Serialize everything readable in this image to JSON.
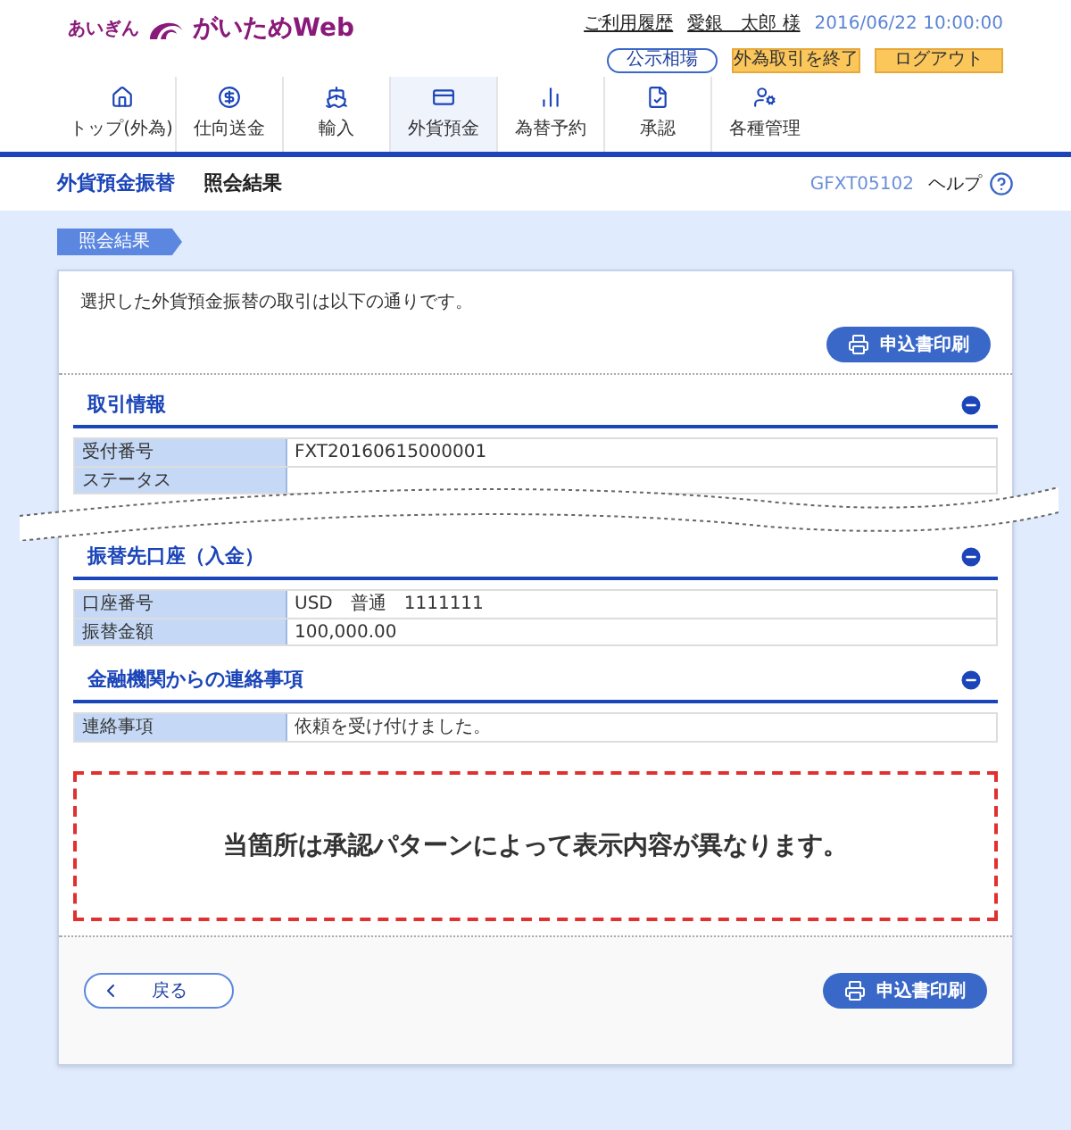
{
  "header": {
    "logo_small": "あいぎん",
    "logo": "がいためWeb",
    "history_link": "ご利用履歴",
    "user_name": "愛銀　太郎 様",
    "datetime": "2016/06/22 10:00:00"
  },
  "header_buttons": [
    {
      "label": "公示相場",
      "kind": "outline"
    },
    {
      "label": "外為取引を終了",
      "kind": "warning"
    },
    {
      "label": "ログアウト",
      "kind": "warning"
    }
  ],
  "nav": [
    {
      "label": "トップ(外為)",
      "selected": false
    },
    {
      "label": "仕向送金",
      "selected": false
    },
    {
      "label": "輸入",
      "selected": false
    },
    {
      "label": "外貨預金",
      "selected": true
    },
    {
      "label": "為替予約",
      "selected": false
    },
    {
      "label": "承認",
      "selected": false
    },
    {
      "label": "各種管理",
      "selected": false
    }
  ],
  "page": {
    "title": "外貨預金振替",
    "subtitle": "照会結果",
    "screen_id": "GFXT05102",
    "help": "ヘルプ"
  },
  "breadcrumb": "照会結果",
  "intro": "選択した外貨預金振替の取引は以下の通りです。",
  "print_button": "申込書印刷",
  "sections": [
    {
      "title": "取引情報",
      "expanded": true,
      "break_after": true,
      "rows": [
        {
          "label": "受付番号",
          "value": "FXT20160615000001"
        },
        {
          "label": "ステータス"
        }
      ]
    },
    {
      "title": "振替先口座（入金）",
      "expanded": true,
      "break_after": false,
      "rows": [
        {
          "label": "口座番号",
          "value": "USD　普通　1111111"
        },
        {
          "label": "振替金額",
          "value": "100,000.00"
        }
      ]
    },
    {
      "title": "金融機関からの連絡事項",
      "expanded": true,
      "break_after": false,
      "rows": [
        {
          "label": "連絡事項",
          "value": "依頼を受け付けました。"
        }
      ]
    }
  ],
  "notice": "当箇所は承認パターンによって表示内容が異なります。",
  "footer": {
    "back_button": "戻る",
    "print_button": "申込書印刷"
  }
}
